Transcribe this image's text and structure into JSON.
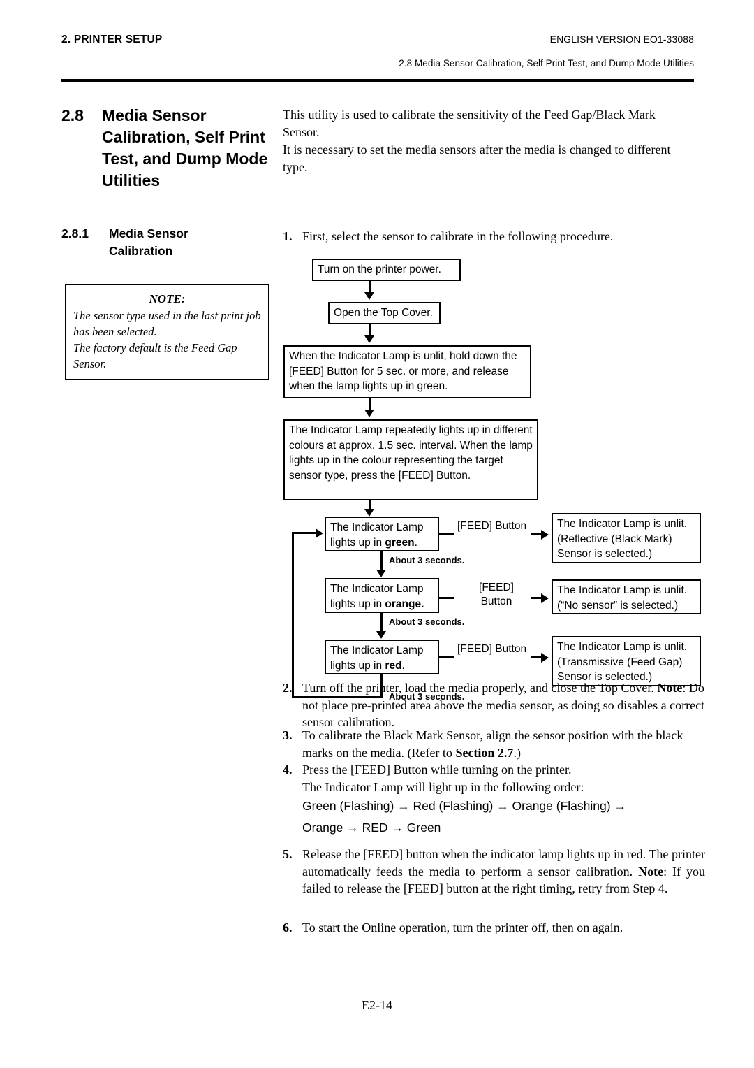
{
  "header": {
    "left": "2. PRINTER SETUP",
    "right": "ENGLISH VERSION EO1-33088",
    "subline": "2.8 Media Sensor Calibration, Self Print Test, and Dump Mode Utilities"
  },
  "section": {
    "number": "2.8",
    "line1": "Media Sensor",
    "line2": "Calibration, Self Print",
    "line3": "Test, and Dump Mode",
    "line4": "Utilities"
  },
  "intro": {
    "para1": "This utility is used to calibrate the sensitivity of the Feed Gap/Black Mark Sensor.",
    "para2": "It is necessary to set the media sensors after the media is changed to different type."
  },
  "subsection": {
    "number": "2.8.1",
    "line1": "Media Sensor",
    "line2": "Calibration"
  },
  "note_box": {
    "heading": "NOTE:",
    "line1": "The sensor type used in the last print job has been selected.",
    "line2": "The factory default is the Feed Gap Sensor."
  },
  "steps": {
    "s1": {
      "num": "1.",
      "text": "First, select the sensor to calibrate in the following procedure."
    },
    "s2": {
      "num": "2.",
      "text": "Turn off the printer, load the media properly, and close the Top Cover.",
      "note_label": "Note",
      "note_text": ": Do not place pre-printed area above the media sensor, as doing so disables a correct sensor calibration."
    },
    "s3": {
      "num": "3.",
      "text_a": "To calibrate the Black Mark Sensor, align the sensor position with the black marks on the media.  (Refer to ",
      "ref": "Section 2.7",
      "text_b": ".)"
    },
    "s4": {
      "num": "4.",
      "text": "Press the [FEED] Button while turning on the printer.",
      "text2": "The Indicator Lamp will light up in the following order:",
      "order_line1": "Green (Flashing)  →  Red (Flashing)  →  Orange (Flashing)  →",
      "order_line2": "Orange  →  RED  →  Green"
    },
    "s5": {
      "num": "5.",
      "text": "Release the [FEED] button when the indicator lamp lights up in red. The printer automatically feeds the media to perform a sensor calibration.",
      "note_label": "Note",
      "note_text": ": If you failed to release the [FEED] button at the right timing, retry from Step 4."
    },
    "s6": {
      "num": "6.",
      "text": "To start the Online operation, turn the printer off, then on again."
    }
  },
  "flowchart": {
    "box1": "Turn on the printer power.",
    "box2": "Open the Top Cover.",
    "box3": "When the Indicator Lamp is unlit, hold down the [FEED] Button for 5 sec. or more, and release when the lamp lights up in green.",
    "box4": "The Indicator Lamp repeatedly lights up in different colours at approx. 1.5 sec. interval. When the lamp lights up in the colour representing the target sensor type, press the [FEED] Button.",
    "row1": {
      "left_prefix": "The Indicator Lamp lights up in ",
      "left_colour": "green",
      "left_suffix": ".",
      "mid": "[FEED] Button",
      "right": "The Indicator Lamp is unlit. (Reflective (Black Mark) Sensor is selected.)",
      "delay": "About 3 seconds."
    },
    "row2": {
      "left_prefix": "The Indicator Lamp lights up in ",
      "left_colour": "orange.",
      "left_suffix": "",
      "mid_line1": "[FEED]",
      "mid_line2": "Button",
      "right": "The Indicator Lamp is unlit. (“No sensor” is selected.)",
      "delay": "About 3 seconds."
    },
    "row3": {
      "left_prefix": "The Indicator Lamp lights up in ",
      "left_colour": "red",
      "left_suffix": ".",
      "mid": "[FEED] Button",
      "right": "The Indicator Lamp is unlit. (Transmissive (Feed Gap) Sensor is selected.)",
      "delay": "About 3 seconds."
    }
  },
  "footer": {
    "page": "E2-14"
  }
}
